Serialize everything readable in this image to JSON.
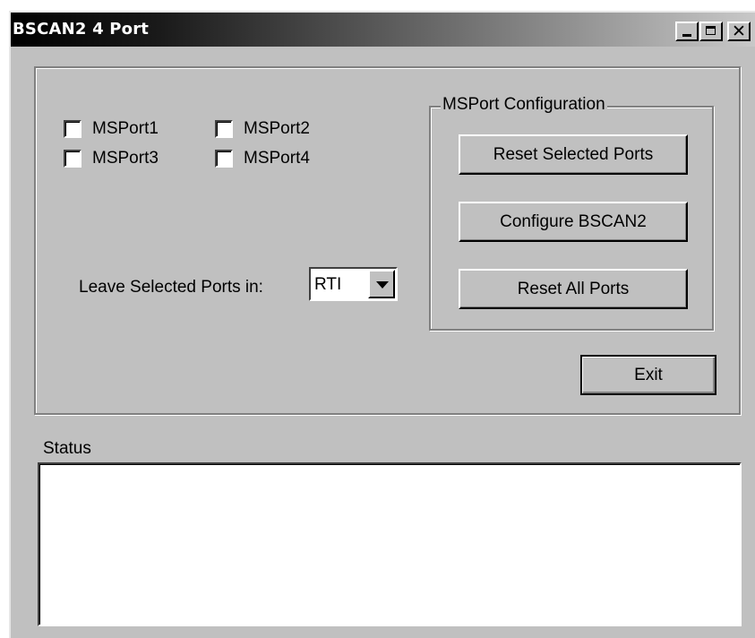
{
  "window": {
    "title": "BSCAN2 4 Port",
    "controls": {
      "minimize_icon": "minimize-icon",
      "maximize_icon": "maximize-icon",
      "close_icon": "close-icon"
    }
  },
  "ports": {
    "checkboxes": [
      {
        "label": "MSPort1",
        "checked": false
      },
      {
        "label": "MSPort2",
        "checked": false
      },
      {
        "label": "MSPort3",
        "checked": false
      },
      {
        "label": "MSPort4",
        "checked": false
      }
    ]
  },
  "leave": {
    "label": "Leave Selected Ports in:",
    "selected": "RTI"
  },
  "config": {
    "legend": "MSPort Configuration",
    "reset_selected_label": "Reset Selected Ports",
    "configure_label": "Configure BSCAN2",
    "reset_all_label": "Reset All Ports"
  },
  "exit_label": "Exit",
  "status": {
    "label": "Status",
    "text": ""
  },
  "colors": {
    "face": "#c0c0c0",
    "shadow": "#808080",
    "highlight": "#ffffff"
  }
}
